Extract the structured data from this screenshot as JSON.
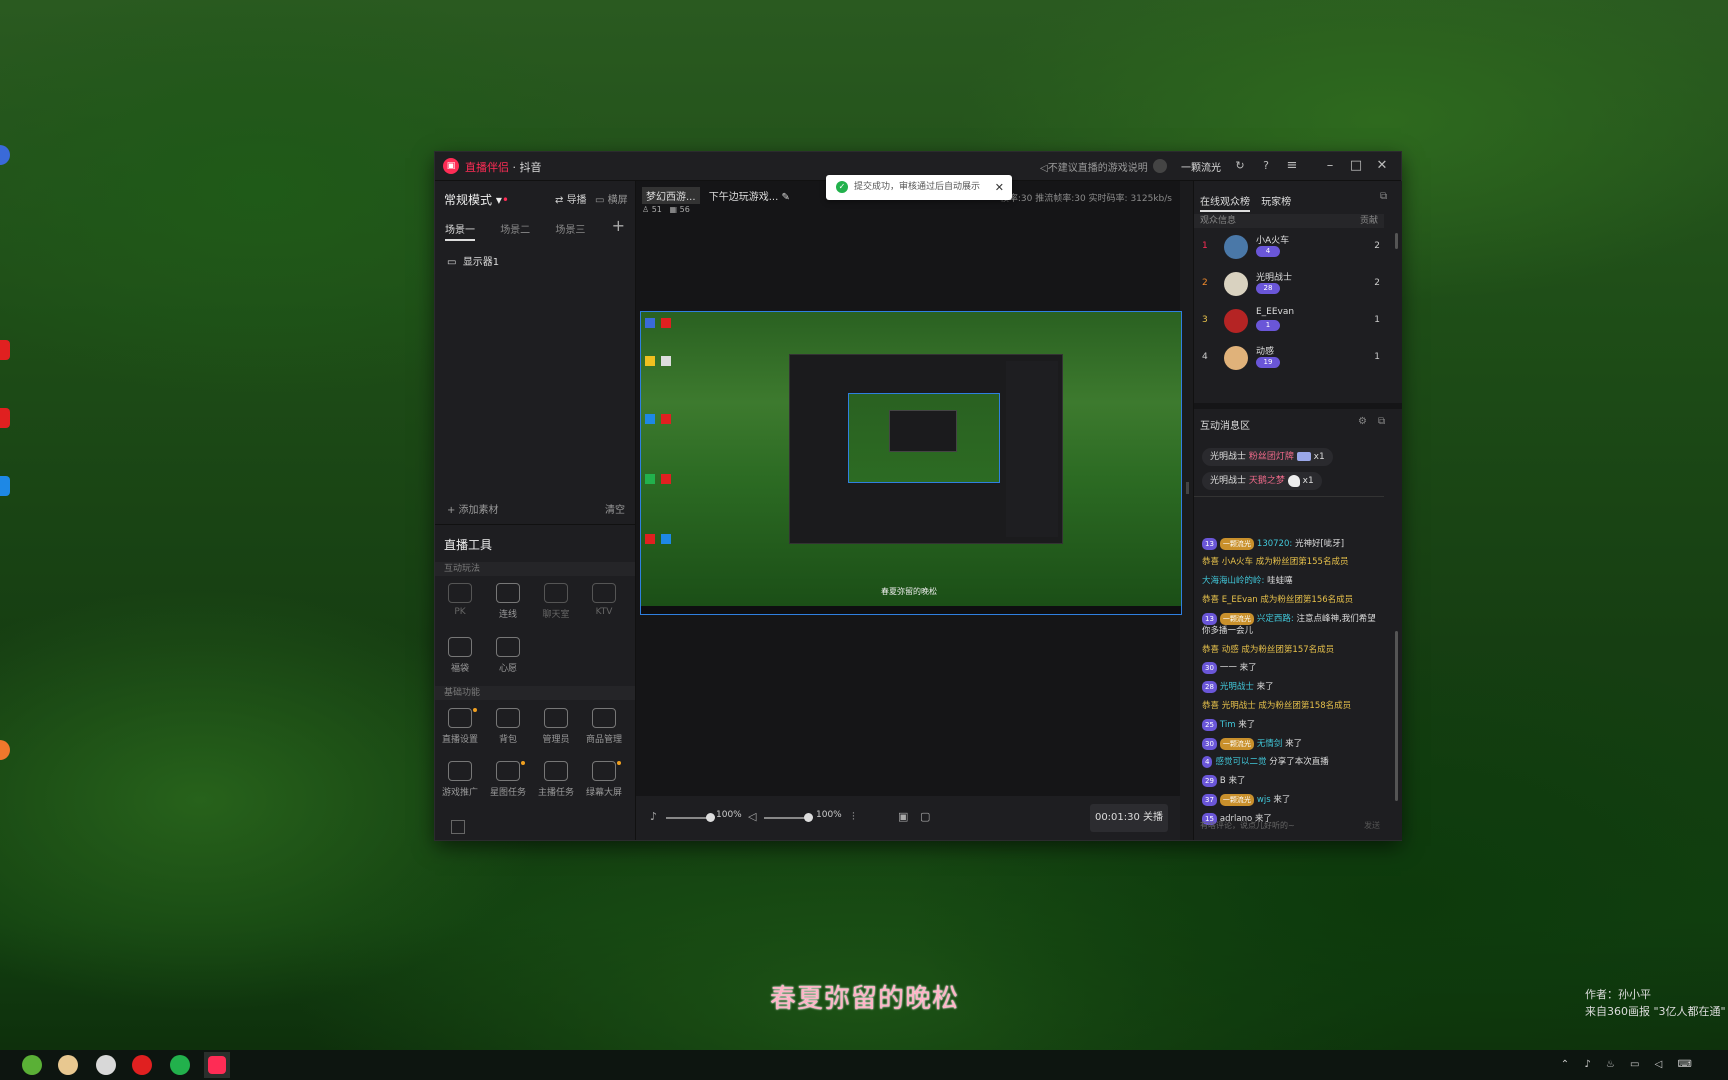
{
  "app": {
    "title_brand": "直播伴侣",
    "title_platform": "· 抖音",
    "notice": "不建议直播的游戏说明",
    "username": "一颗流光"
  },
  "left_panel": {
    "mode": "常规模式",
    "guide_btn": "导播",
    "landscape_btn": "横屏",
    "scenes": [
      "场景一",
      "场景二",
      "场景三"
    ],
    "source": "显示器1",
    "add_source": "+ 添加素材",
    "clear": "清空",
    "tools_title": "直播工具",
    "section_interactive": "互动玩法",
    "interactive_tools": [
      "PK",
      "连线",
      "聊天室",
      "KTV",
      "福袋",
      "心愿"
    ],
    "section_basic": "基础功能",
    "basic_tools": [
      "直播设置",
      "背包",
      "管理员",
      "商品管理",
      "游戏推广",
      "星图任务",
      "主播任务",
      "绿幕大屏"
    ]
  },
  "center": {
    "stream_title_chip": "梦幻西游...",
    "stream_title": "下午边玩游戏...",
    "viewers": "51",
    "likes": "56",
    "rates": "帧率:30   推流帧率:30   实时码率: 3125kb/s",
    "toast": "提交成功，审核通过后自动展示",
    "preview_caption": "春夏弥留的晚松",
    "mic_volume": "100%",
    "speaker_volume": "100%",
    "mic_level": 1.0,
    "speaker_level": 1.0,
    "end_button": "00:01:30 关播"
  },
  "right_panel": {
    "tabs": [
      "在线观众榜",
      "玩家榜"
    ],
    "subhead_left": "观众信息",
    "subhead_right": "贡献",
    "viewers": [
      {
        "rank": "1",
        "name": "小A火车",
        "level": "4",
        "count": "2",
        "rank_color": "#fe2c55",
        "avatar_color": "#4a78a8"
      },
      {
        "rank": "2",
        "name": "光明战士",
        "level": "28",
        "count": "2",
        "rank_color": "#f08a2c",
        "avatar_color": "#d9d2c0"
      },
      {
        "rank": "3",
        "name": "E_EEvan",
        "level": "1",
        "count": "1",
        "rank_color": "#e7c14b",
        "avatar_color": "#b52424"
      },
      {
        "rank": "4",
        "name": "动感",
        "level": "19",
        "count": "1",
        "rank_color": "#cccccc",
        "avatar_color": "#e0b27a"
      }
    ],
    "interact_title": "互动消息区",
    "gifts": [
      {
        "user": "光明战士",
        "gift": "粉丝团灯牌",
        "qty": "x1"
      },
      {
        "user": "光明战士",
        "gift": "天鹅之梦",
        "qty": "x1"
      }
    ],
    "messages": [
      {
        "lv": "13",
        "fan": "一颗流光",
        "user": "130720:",
        "text": "光神好[呲牙]",
        "style": "c"
      },
      {
        "lv": "",
        "fan": "",
        "user": "恭喜 小A火车",
        "text": "成为粉丝团第155名成员",
        "style": "y"
      },
      {
        "lv": "",
        "fan": "",
        "user": "大海海山岭的岭:",
        "text": "哇蛙噻",
        "style": "c"
      },
      {
        "lv": "",
        "fan": "",
        "user": "恭喜 E_EEvan",
        "text": "成为粉丝团第156名成员",
        "style": "y"
      },
      {
        "lv": "13",
        "fan": "一颗流光",
        "user": "兴定西路:",
        "text": "注意点峰神,我们希望你多播一会儿",
        "style": "c"
      },
      {
        "lv": "",
        "fan": "",
        "user": "恭喜 动感",
        "text": "成为粉丝团第157名成员",
        "style": "y"
      },
      {
        "lv": "30",
        "fan": "",
        "user": "一一",
        "text": "来了",
        "style": "w"
      },
      {
        "lv": "28",
        "fan": "",
        "user": "光明战士",
        "text": "来了",
        "style": "c"
      },
      {
        "lv": "",
        "fan": "",
        "user": "恭喜 光明战士",
        "text": "成为粉丝团第158名成员",
        "style": "y"
      },
      {
        "lv": "25",
        "fan": "",
        "user": "Tim",
        "text": "来了",
        "style": "c"
      },
      {
        "lv": "30",
        "fan": "一颗流光",
        "user": "无情剑",
        "text": "来了",
        "style": "c"
      },
      {
        "lv": "4",
        "fan": "",
        "user": "感觉可以二觉",
        "text": "分享了本次直播",
        "style": "c"
      },
      {
        "lv": "29",
        "fan": "",
        "user": "B",
        "text": "来了",
        "style": "w"
      },
      {
        "lv": "37",
        "fan": "一颗流光",
        "user": "wjs",
        "text": "来了",
        "style": "c"
      },
      {
        "lv": "15",
        "fan": "",
        "user": "adrlano",
        "text": "来了",
        "style": "w"
      }
    ],
    "input_placeholder": "有啥评论，说点儿好听的~",
    "send": "发送"
  },
  "desktop": {
    "caption": "春夏弥留的晚松",
    "watermark_author": "作者：孙小平",
    "watermark_source": "来自360画报 \"3亿人都在通\""
  },
  "taskbar": {
    "tray_icons": [
      "^",
      "mic",
      "fire",
      "net",
      "vol",
      "kbd"
    ]
  }
}
